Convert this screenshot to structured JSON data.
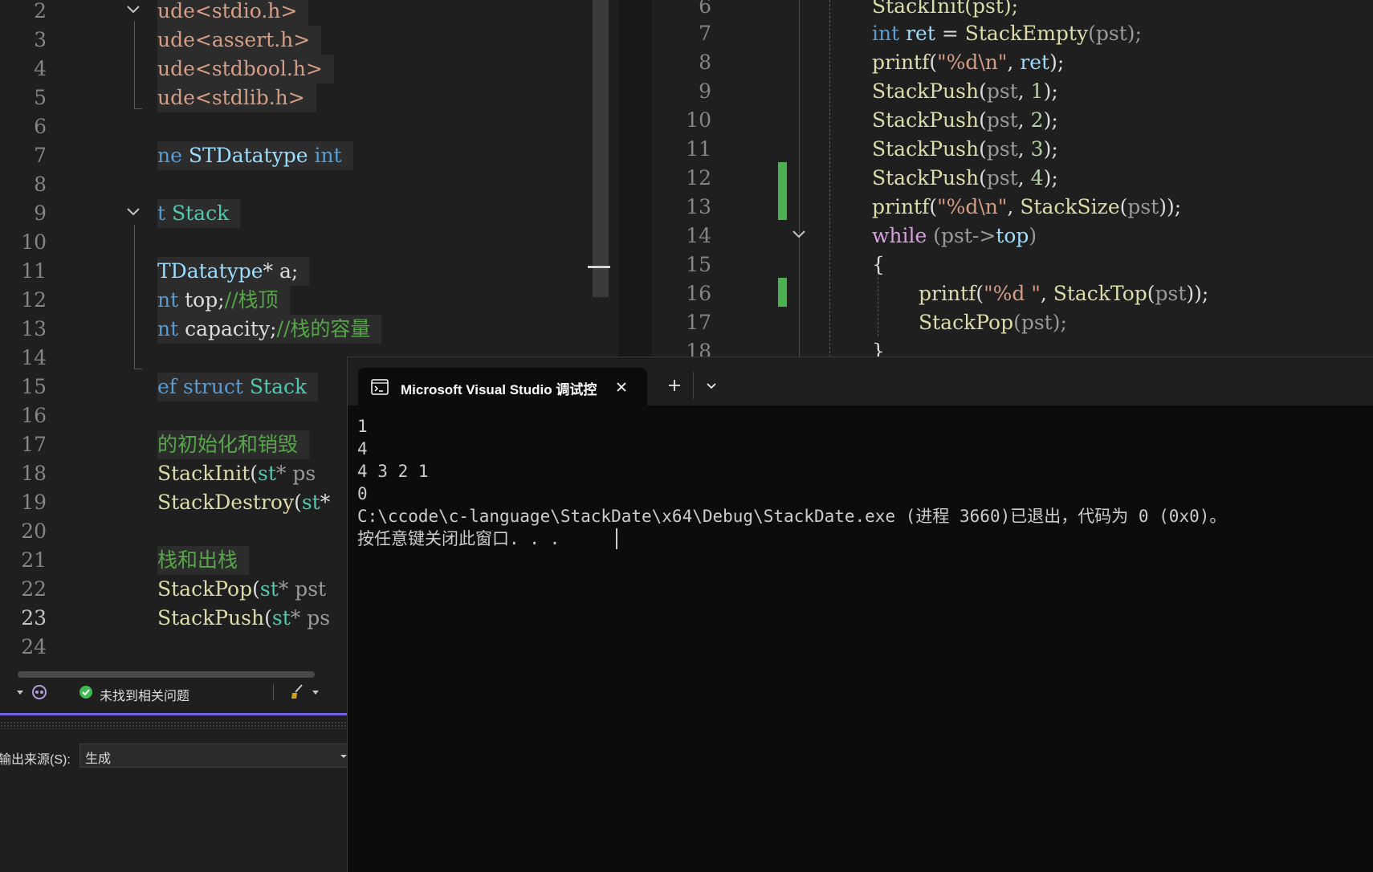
{
  "left_editor": {
    "line_numbers": [
      "2",
      "3",
      "4",
      "5",
      "6",
      "7",
      "8",
      "9",
      "10",
      "11",
      "12",
      "13",
      "14",
      "15",
      "16",
      "17",
      "18",
      "19",
      "20",
      "21",
      "22",
      "23",
      "24"
    ],
    "active_line": "23",
    "lines": {
      "l2": "ude<stdio.h>",
      "l3": "ude<assert.h>",
      "l4": "ude<stdbool.h>",
      "l5": "ude<stdlib.h>",
      "l7a": "ne ",
      "l7b": "STDatatype",
      "l7c": " int",
      "l9a": "t ",
      "l9b": "Stack",
      "l11a": "TDatatype",
      "l11b": "* a;",
      "l12a": "nt",
      "l12b": " top;",
      "l12c": "//栈顶",
      "l13a": "nt",
      "l13b": " capacity;",
      "l13c": "//栈的容量",
      "l15a": "ef ",
      "l15b": "struct",
      "l15c": " Stack",
      "l17": "的初始化和销毁",
      "l18a": "StackInit",
      "l18b": "(",
      "l18c": "st",
      "l18d": "* ps",
      "l19a": "StackDestroy",
      "l19b": "(",
      "l19c": "st",
      "l19d": "*",
      "l21": "栈和出栈",
      "l22a": "StackPop",
      "l22b": "(",
      "l22c": "st",
      "l22d": "* pst",
      "l23a": "StackPush",
      "l23b": "(",
      "l23c": "st",
      "l23d": "* ps"
    }
  },
  "status": {
    "no_issues": "未找到相关问题"
  },
  "output_panel": {
    "source_label": "输出来源(S):",
    "source_value": "生成"
  },
  "right_editor": {
    "line_numbers": [
      "6",
      "7",
      "8",
      "9",
      "10",
      "11",
      "12",
      "13",
      "14",
      "15",
      "16",
      "17",
      "18"
    ],
    "l6": "StackInit(pst);",
    "l7a": "int",
    "l7b": "ret",
    "l7c": " = ",
    "l7d": "StackEmpty",
    "l7e": "(pst);",
    "l8a": "printf",
    "l8b": "(",
    "l8c": "\"%d\\n\"",
    "l8d": ", ",
    "l8e": "ret",
    "l8f": ");",
    "push_fn": "StackPush",
    "pst": "pst",
    "l9n": "1",
    "l10n": "2",
    "l11n": "3",
    "l12n": "4",
    "l13a": "printf",
    "l13c": "\"%d\\n\"",
    "l13e": "StackSize",
    "l14a": "while",
    "l14b": " (pst->",
    "l14c": "top",
    "l14d": ")",
    "l15": "{",
    "l16a": "printf",
    "l16c": "\"%d \"",
    "l16e": "StackTop",
    "l17a": "StackPop",
    "l17b": "(pst);",
    "l18": "}"
  },
  "console": {
    "tab_title": "Microsoft Visual Studio 调试控",
    "tab_icon": "terminal-icon",
    "close_icon": "close-icon",
    "new_tab": "+",
    "dropdown_icon": "chevron-down-icon",
    "output_lines": [
      "1",
      "4",
      "4 3 2 1",
      "0",
      "C:\\ccode\\c-language\\StackDate\\x64\\Debug\\StackDate.exe (进程 3660)已退出，代码为 0 (0x0)。",
      "按任意键关闭此窗口. . ."
    ]
  },
  "colors": {
    "accent": "#7160e8",
    "change_marker": "#4caf50",
    "editor_bg": "#1f1f1f",
    "console_bg": "#0c0c0c"
  }
}
